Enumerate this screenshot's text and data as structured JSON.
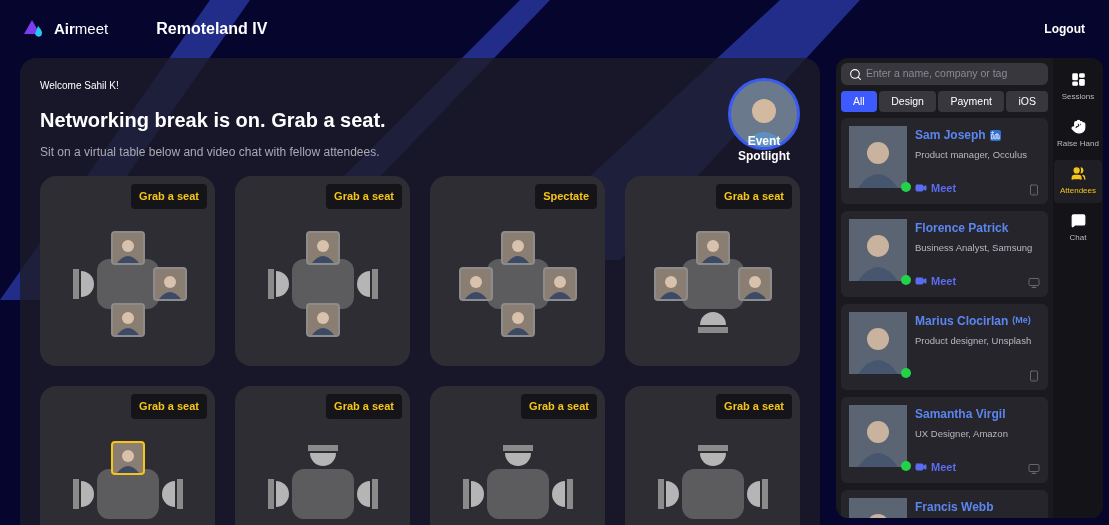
{
  "header": {
    "logo_text": "**Air**meet",
    "event_title": "Remoteland IV",
    "logout": "Logout"
  },
  "lounge": {
    "welcome": "Welcome Sahil K!",
    "heading": "Networking break is on. Grab a seat.",
    "subheading": "Sit on a virtual table below and video chat with fellow attendees.",
    "spotlight_label": "Event Spotlight",
    "tables": [
      {
        "action": "Grab a seat",
        "seats": {
          "top": {
            "kind": "person",
            "highlighted": false
          },
          "right": {
            "kind": "person",
            "highlighted": false
          },
          "bottom": {
            "kind": "person",
            "highlighted": false
          },
          "left": {
            "kind": "empty"
          }
        }
      },
      {
        "action": "Grab a seat",
        "seats": {
          "top": {
            "kind": "person",
            "highlighted": false
          },
          "right": {
            "kind": "empty"
          },
          "bottom": {
            "kind": "person",
            "highlighted": false
          },
          "left": {
            "kind": "empty"
          }
        }
      },
      {
        "action": "Spectate",
        "seats": {
          "top": {
            "kind": "person",
            "highlighted": false
          },
          "right": {
            "kind": "person",
            "highlighted": false
          },
          "bottom": {
            "kind": "person",
            "highlighted": false
          },
          "left": {
            "kind": "person",
            "highlighted": false
          }
        }
      },
      {
        "action": "Grab a seat",
        "seats": {
          "top": {
            "kind": "person",
            "highlighted": false
          },
          "right": {
            "kind": "person",
            "highlighted": false
          },
          "bottom": {
            "kind": "empty"
          },
          "left": {
            "kind": "person",
            "highlighted": false
          }
        }
      },
      {
        "action": "Grab a seat",
        "seats": {
          "top": {
            "kind": "person",
            "highlighted": true
          },
          "right": {
            "kind": "empty"
          },
          "left": {
            "kind": "empty"
          }
        }
      },
      {
        "action": "Grab a seat",
        "seats": {
          "top": {
            "kind": "empty"
          },
          "right": {
            "kind": "empty"
          },
          "left": {
            "kind": "empty"
          }
        }
      },
      {
        "action": "Grab a seat",
        "seats": {
          "top": {
            "kind": "empty"
          },
          "right": {
            "kind": "empty"
          },
          "left": {
            "kind": "empty"
          }
        }
      },
      {
        "action": "Grab a seat",
        "seats": {
          "top": {
            "kind": "empty"
          },
          "right": {
            "kind": "empty"
          },
          "left": {
            "kind": "empty"
          }
        }
      }
    ]
  },
  "people_panel": {
    "search": {
      "placeholder": "Enter a name, company or tag"
    },
    "filters": [
      {
        "label": "All",
        "selected": true
      },
      {
        "label": "Design",
        "selected": false
      },
      {
        "label": "Payment",
        "selected": false
      },
      {
        "label": "iOS",
        "selected": false
      }
    ],
    "attendees": [
      {
        "name": "Sam Joseph",
        "linkedin": true,
        "title": "Product manager, Occulus",
        "meet": "Meet",
        "online": true,
        "kind": "mobile"
      },
      {
        "name": "Florence Patrick",
        "linkedin": false,
        "title": "Business Analyst, Samsung",
        "meet": "Meet",
        "online": true,
        "kind": "desktop"
      },
      {
        "name": "Marius Clocirlan",
        "tag": "(Me)",
        "linkedin": false,
        "title": "Product designer, Unsplash",
        "online": true,
        "kind": "mobile"
      },
      {
        "name": "Samantha Virgil",
        "linkedin": false,
        "title": "UX Designer, Amazon",
        "meet": "Meet",
        "online": true,
        "kind": "desktop"
      },
      {
        "name": "Francis Webb"
      }
    ]
  },
  "rail": [
    {
      "kind": "sessions",
      "label": "Sessions",
      "selected": false
    },
    {
      "kind": "hand",
      "label": "Raise Hand",
      "selected": false
    },
    {
      "kind": "attendees",
      "label": "Attendees",
      "selected": true
    },
    {
      "kind": "chat",
      "label": "Chat",
      "selected": false
    }
  ]
}
